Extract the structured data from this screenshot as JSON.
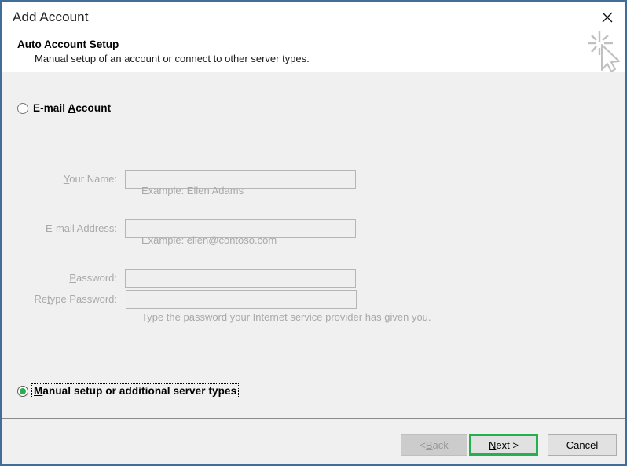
{
  "window": {
    "title": "Add Account",
    "close_icon": "close-icon",
    "border_color": "#3f6f99"
  },
  "header": {
    "heading": "Auto Account Setup",
    "subtitle": "Manual setup of an account or connect to other server types.",
    "decoration_icon": "cursor-sparkle-icon"
  },
  "options": {
    "email_account": {
      "label_before": "E-mail ",
      "accelerator": "A",
      "label_after": "ccount",
      "selected": false
    },
    "manual_setup": {
      "accelerator": "M",
      "label_after": "anual setup or additional server types",
      "selected": true,
      "focused": true,
      "dot_color": "#22b14c"
    }
  },
  "form": {
    "enabled": false,
    "fields": [
      {
        "label_before": "",
        "accelerator": "Y",
        "label_after": "our Name:",
        "value": "",
        "placeholder": ""
      },
      {
        "label_before": "",
        "accelerator": "E",
        "label_after": "-mail Address:",
        "value": "",
        "placeholder": ""
      },
      {
        "label_before": "",
        "accelerator": "P",
        "label_after": "assword:",
        "value": "",
        "placeholder": ""
      },
      {
        "label_before": "Re",
        "accelerator": "t",
        "label_after": "ype Password:",
        "value": "",
        "placeholder": ""
      }
    ],
    "hints": {
      "name_example": "Example: Ellen Adams",
      "email_example": "Example: ellen@contoso.com",
      "password_note": "Type the password your Internet service provider has given you."
    }
  },
  "footer": {
    "back": {
      "label": "< ",
      "accelerator": "B",
      "label_after": "ack",
      "disabled": true
    },
    "next": {
      "accelerator": "N",
      "label_after": "ext >",
      "disabled": false,
      "highlight_color": "#22b14c"
    },
    "cancel": {
      "label": "Cancel",
      "disabled": false
    }
  }
}
